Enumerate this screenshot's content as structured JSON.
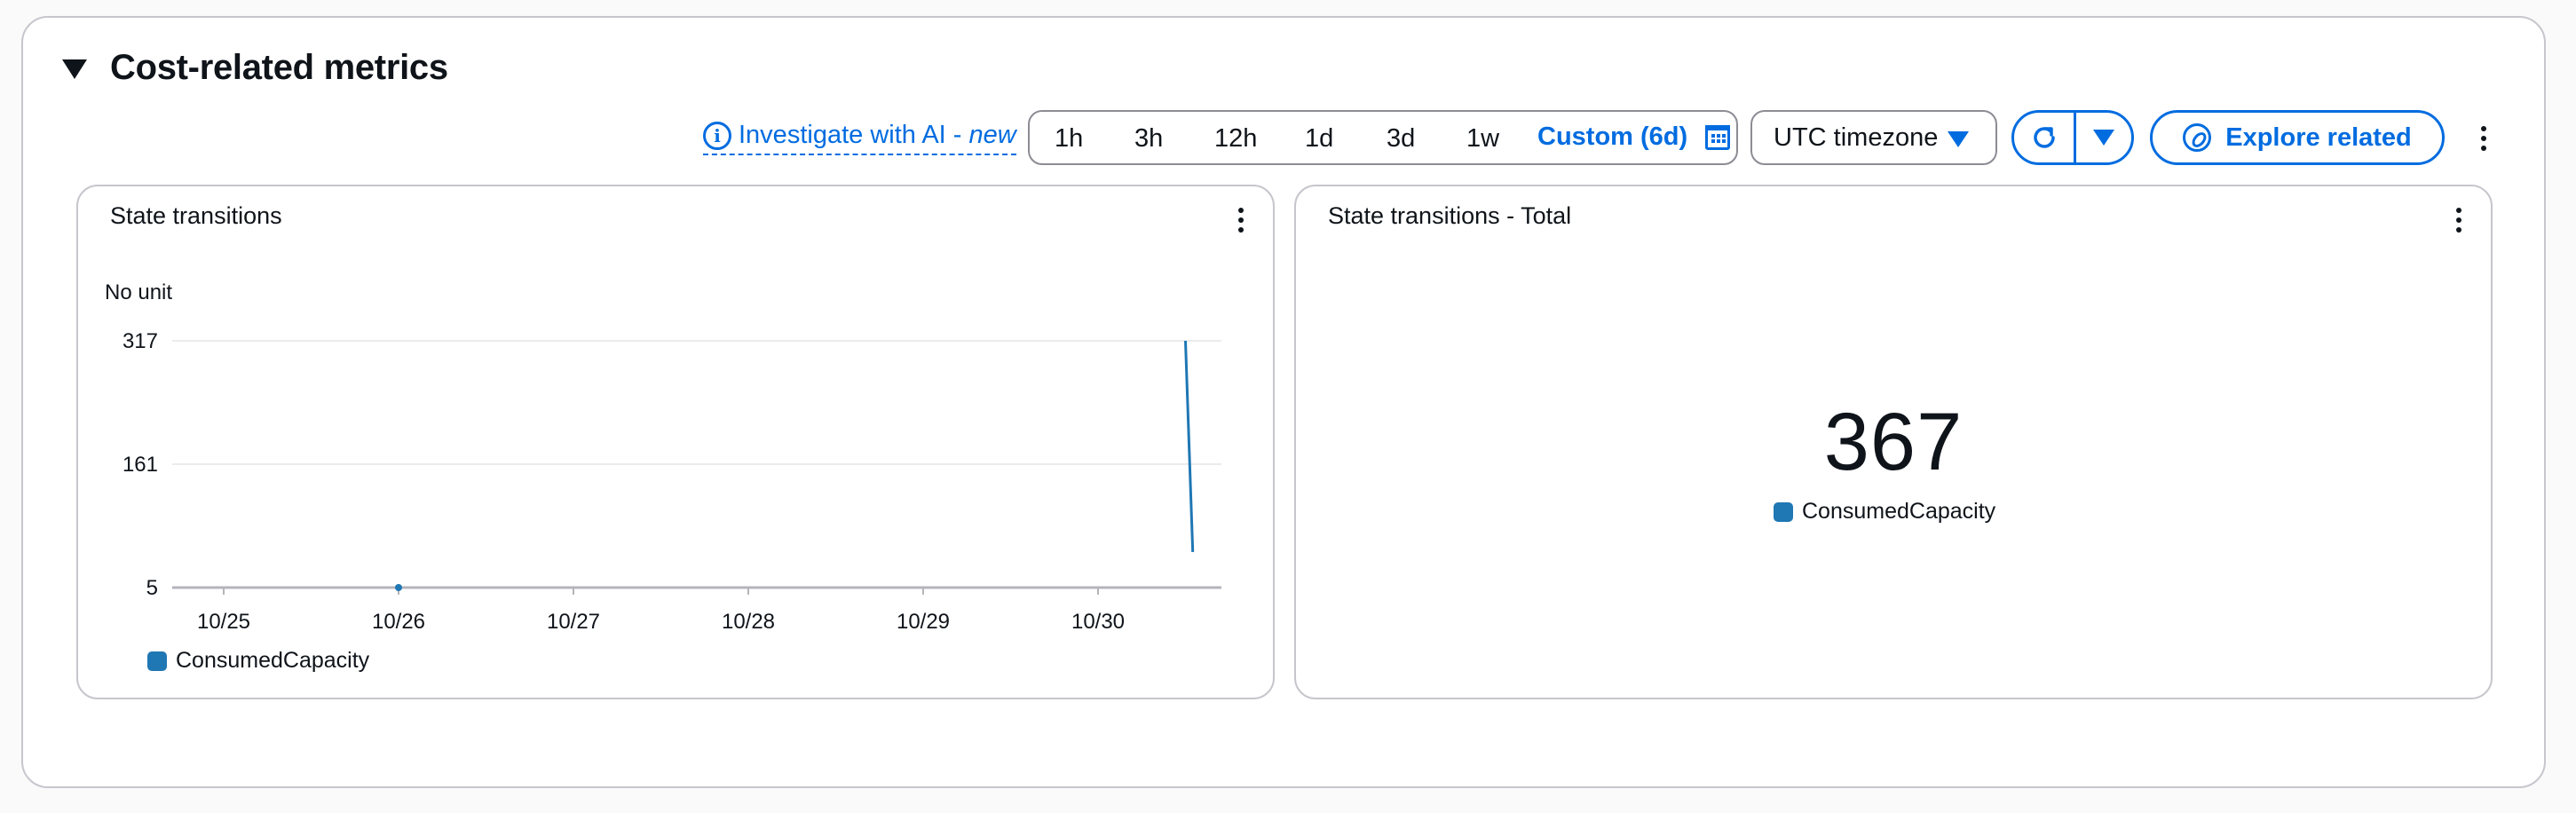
{
  "section": {
    "title": "Cost-related metrics"
  },
  "toolbar": {
    "investigate_label": "Investigate with AI -",
    "investigate_new": "new",
    "ranges": [
      "1h",
      "3h",
      "12h",
      "1d",
      "3d",
      "1w"
    ],
    "custom_label": "Custom (6d)",
    "timezone": "UTC timezone",
    "explore_label": "Explore related"
  },
  "widgets": {
    "line": {
      "title": "State transitions",
      "unit": "No unit",
      "legend": "ConsumedCapacity"
    },
    "total": {
      "title": "State transitions - Total",
      "value": "367",
      "legend": "ConsumedCapacity"
    }
  },
  "colors": {
    "accent": "#006ce0",
    "series": "#1f77b4"
  },
  "chart_data": {
    "type": "line",
    "title": "State transitions",
    "ylabel": "No unit",
    "ylim": [
      5,
      317
    ],
    "yticks": [
      5,
      161,
      317
    ],
    "x_tick_labels": [
      "10/25",
      "10/26",
      "10/27",
      "10/28",
      "10/29",
      "10/30"
    ],
    "grid": true,
    "legend_placement": "bottom-left",
    "series": [
      {
        "name": "ConsumedCapacity",
        "points": [
          {
            "x": "10/26",
            "y": 5
          },
          {
            "x": "10/30 12:00",
            "y": 317
          },
          {
            "x": "10/30 13:00",
            "y": 50
          }
        ]
      }
    ]
  }
}
